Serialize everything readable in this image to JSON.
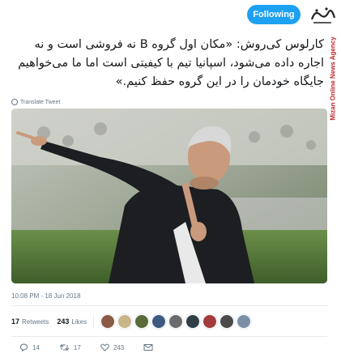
{
  "header": {
    "follow_label": "Following",
    "brand_vertical": "Mizan Online News Agency"
  },
  "tweet": {
    "text": "کارلوس کی‌روش: «مکان اول گروه B نه فروشی است و نه اجاره داده می‌شود، اسپانیا تیم با کیفیتی است اما ما می‌خواهیم جایگاه خودمان را در این گروه حفظ کنیم.»",
    "translate_label": "Translate Tweet",
    "timestamp": "10:08 PM - 18 Jun 2018"
  },
  "stats": {
    "retweets_count": "17",
    "retweets_label": "Retweets",
    "likes_count": "243",
    "likes_label": "Likes",
    "avatar_colors": [
      "#8a5a44",
      "#c9b48a",
      "#5a6b3a",
      "#3d5a80",
      "#6b6b6b",
      "#2f3e46",
      "#a33b3b",
      "#4a4a4a",
      "#7a8fa6"
    ]
  },
  "actions": {
    "reply_count": "14",
    "retweet_count": "17",
    "like_count": "243"
  },
  "colors": {
    "accent": "#1da1f2",
    "brand": "#c0272d",
    "muted": "#657786"
  }
}
